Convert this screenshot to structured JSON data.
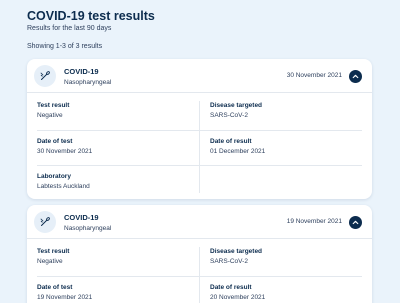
{
  "page": {
    "title": "COVID-19 test results",
    "subtitle": "Results for the last 90 days",
    "count": "Showing 1-3 of 3 results"
  },
  "colors": {
    "background": "#eaf3fb",
    "accent": "#0c2c4e",
    "card": "#ffffff"
  },
  "results": [
    {
      "name": "COVID-19",
      "sample": "Nasopharyngeal",
      "date": "30 November 2021",
      "icon": "swab-icon",
      "expanded": true,
      "fields": {
        "test_result_label": "Test result",
        "test_result": "Negative",
        "disease_label": "Disease targeted",
        "disease": "SARS-CoV-2",
        "date_of_test_label": "Date of test",
        "date_of_test": "30 November 2021",
        "date_of_result_label": "Date of result",
        "date_of_result": "01 December 2021",
        "laboratory_label": "Laboratory",
        "laboratory": "Labtests Auckland"
      }
    },
    {
      "name": "COVID-19",
      "sample": "Nasopharyngeal",
      "date": "19 November 2021",
      "icon": "swab-icon",
      "expanded": true,
      "fields": {
        "test_result_label": "Test result",
        "test_result": "Negative",
        "disease_label": "Disease targeted",
        "disease": "SARS-CoV-2",
        "date_of_test_label": "Date of test",
        "date_of_test": "19 November 2021",
        "date_of_result_label": "Date of result",
        "date_of_result": "20 November 2021"
      }
    }
  ]
}
